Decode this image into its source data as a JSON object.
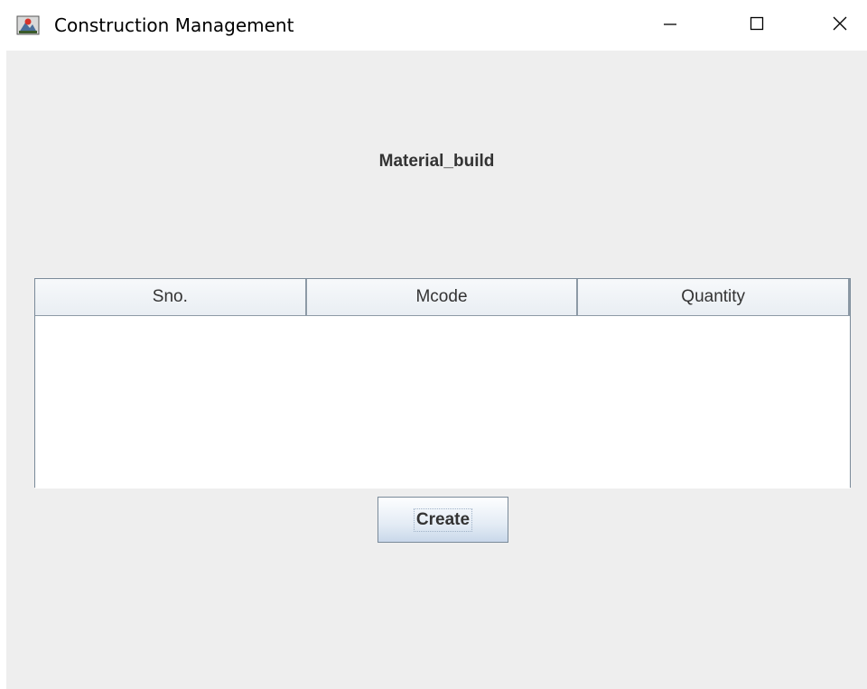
{
  "window": {
    "title": "Construction Management"
  },
  "main": {
    "heading": "Material_build",
    "table": {
      "columns": [
        "Sno.",
        "Mcode",
        "Quantity"
      ],
      "rows": []
    },
    "create_label": "Create"
  },
  "icons": {
    "app": "app-icon",
    "minimize": "minimize-icon",
    "maximize": "maximize-icon",
    "close": "close-icon"
  }
}
